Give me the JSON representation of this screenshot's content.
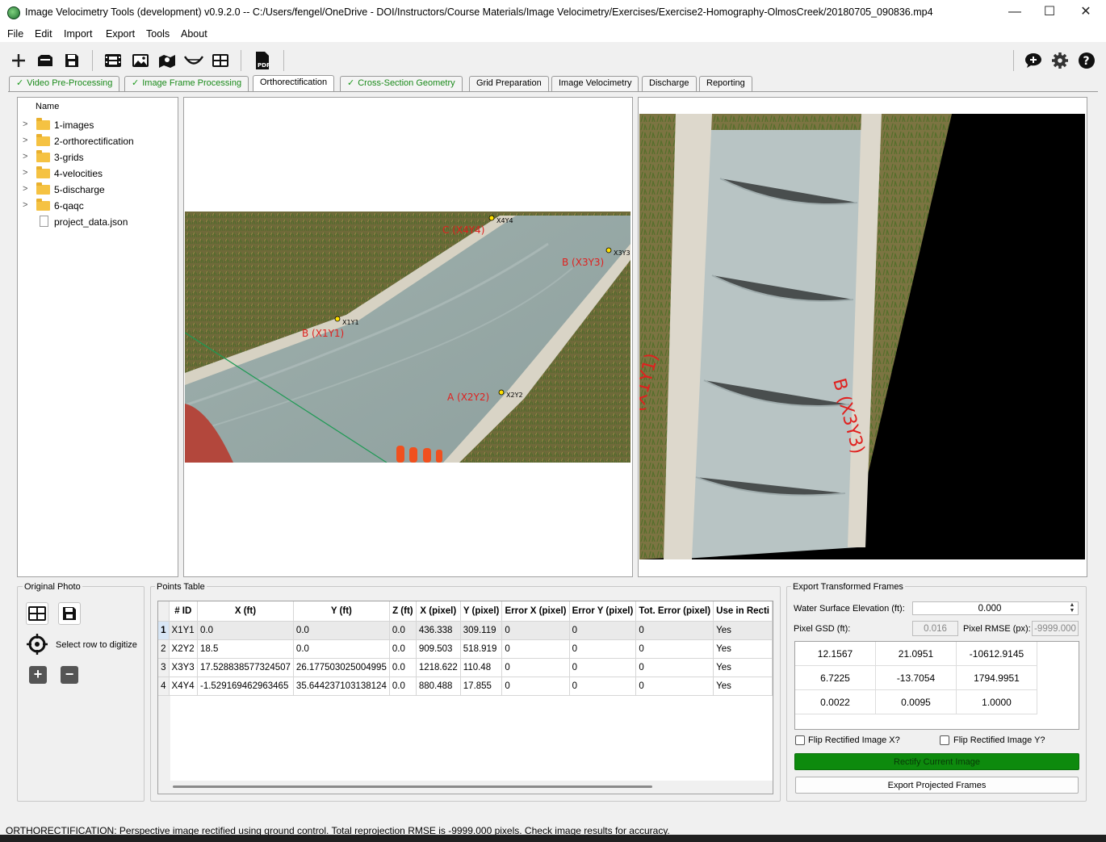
{
  "window": {
    "title": "Image Velocimetry Tools (development) v0.9.2.0 -- C:/Users/fengel/OneDrive - DOI/Instructors/Course Materials/Image Velocimetry/Exercises/Exercise2-Homography-OlmosCreek/20180705_090836.mp4",
    "minimize": "—",
    "maximize": "☐",
    "close": "✕"
  },
  "menu": [
    "File",
    "Edit",
    "Import",
    "Export",
    "Tools",
    "About"
  ],
  "tabs": [
    {
      "label": "Video Pre-Processing",
      "checked": true
    },
    {
      "label": "Image Frame Processing",
      "checked": true
    },
    {
      "label": "Orthorectification",
      "checked": false,
      "active": true
    },
    {
      "label": "Cross-Section Geometry",
      "checked": true
    },
    {
      "label": "Grid Preparation",
      "checked": false
    },
    {
      "label": "Image Velocimetry",
      "checked": false
    },
    {
      "label": "Discharge",
      "checked": false
    },
    {
      "label": "Reporting",
      "checked": false
    }
  ],
  "filetree": {
    "header": "Name",
    "items": [
      "1-images",
      "2-orthorectification",
      "3-grids",
      "4-velocities",
      "5-discharge",
      "6-qaqc",
      "project_data.json"
    ]
  },
  "original_photo": {
    "points": [
      {
        "tag": "X1Y1",
        "label": "B (X1Y1)"
      },
      {
        "tag": "X2Y2",
        "label": "A (X2Y2)"
      },
      {
        "tag": "X3Y3",
        "label": "B (X3Y3)"
      },
      {
        "tag": "X4Y4",
        "label": "C (X4Y4)"
      }
    ]
  },
  "rectified": {
    "labels": [
      "B (X3Y3)",
      "(X1Y1)"
    ]
  },
  "controls": {
    "group_title": "Original Photo",
    "select_row": "Select row to digitize"
  },
  "points_table": {
    "title": "Points Table",
    "columns": [
      "# ID",
      "X (ft)",
      "Y (ft)",
      "Z (ft)",
      "X (pixel)",
      "Y (pixel)",
      "Error X (pixel)",
      "Error Y (pixel)",
      "Tot. Error (pixel)",
      "Use in Recti"
    ],
    "rows": [
      [
        "1",
        "X1Y1",
        "0.0",
        "0.0",
        "0.0",
        "436.338",
        "309.119",
        "0",
        "0",
        "0",
        "Yes"
      ],
      [
        "2",
        "X2Y2",
        "18.5",
        "0.0",
        "0.0",
        "909.503",
        "518.919",
        "0",
        "0",
        "0",
        "Yes"
      ],
      [
        "3",
        "X3Y3",
        "17.528838577324507",
        "26.177503025004995",
        "0.0",
        "1218.622",
        "110.48",
        "0",
        "0",
        "0",
        "Yes"
      ],
      [
        "4",
        "X4Y4",
        "-1.529169462963465",
        "35.644237103138124",
        "0.0",
        "880.488",
        "17.855",
        "0",
        "0",
        "0",
        "Yes"
      ]
    ]
  },
  "export": {
    "title": "Export Transformed Frames",
    "wse_label": "Water Surface Elevation (ft):",
    "wse_value": "0.000",
    "gsd_label": "Pixel GSD (ft):",
    "gsd_value": "0.016",
    "rmse_label": "Pixel RMSE (px):",
    "rmse_value": "-9999.000",
    "matrix": [
      [
        "12.1567",
        "21.0951",
        "-10612.9145"
      ],
      [
        "6.7225",
        "-13.7054",
        "1794.9951"
      ],
      [
        "0.0022",
        "0.0095",
        "1.0000"
      ]
    ],
    "flip_x": "Flip Rectified Image X?",
    "flip_y": "Flip Rectified Image Y?",
    "rectify_btn": "Rectify Current Image",
    "export_btn": "Export Projected Frames"
  },
  "status": "ORTHORECTIFICATION: Perspective image rectified using ground control. Total reprojection RMSE is -9999.000 pixels. Check image results for accuracy.",
  "colors": {
    "accent_green": "#0d8a0d",
    "label_red": "#e0201e",
    "point_yellow": "#ffe000"
  }
}
